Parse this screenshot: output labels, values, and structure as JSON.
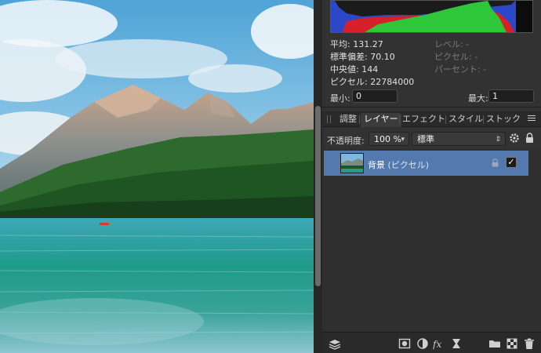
{
  "histogram": {
    "colors": {
      "blue": "#2a48c8",
      "red": "#d6202a",
      "green": "#2fc73a"
    }
  },
  "stats": {
    "mean": "平均: 131.27",
    "stddev": "標準偏差: 70.10",
    "median": "中央値: 144",
    "pixels": "ピクセル: 22784000",
    "level": "レベル: -",
    "pixel_dim": "ピクセル: -",
    "percent": "パーセント: -"
  },
  "range": {
    "min_label": "最小:",
    "min_value": "0",
    "max_label": "最大:",
    "max_value": "1"
  },
  "tabs": {
    "adjust": "調整",
    "layers": "レイヤー",
    "effects": "エフェクト",
    "styles": "スタイル",
    "stock": "ストック"
  },
  "controls": {
    "opacity_label": "不透明度:",
    "opacity_value": "100 %",
    "blend_mode": "標準"
  },
  "layer": {
    "name": "背景",
    "type": "(ピクセル)",
    "visible": "✓"
  },
  "icons": [
    "layers-stack-icon",
    "mask-icon",
    "adjustment-icon",
    "fx-icon",
    "hourglass-icon",
    "folder-icon",
    "checker-icon",
    "trash-icon"
  ],
  "colors": {
    "accent": "#5479ae",
    "panel": "#323232"
  }
}
